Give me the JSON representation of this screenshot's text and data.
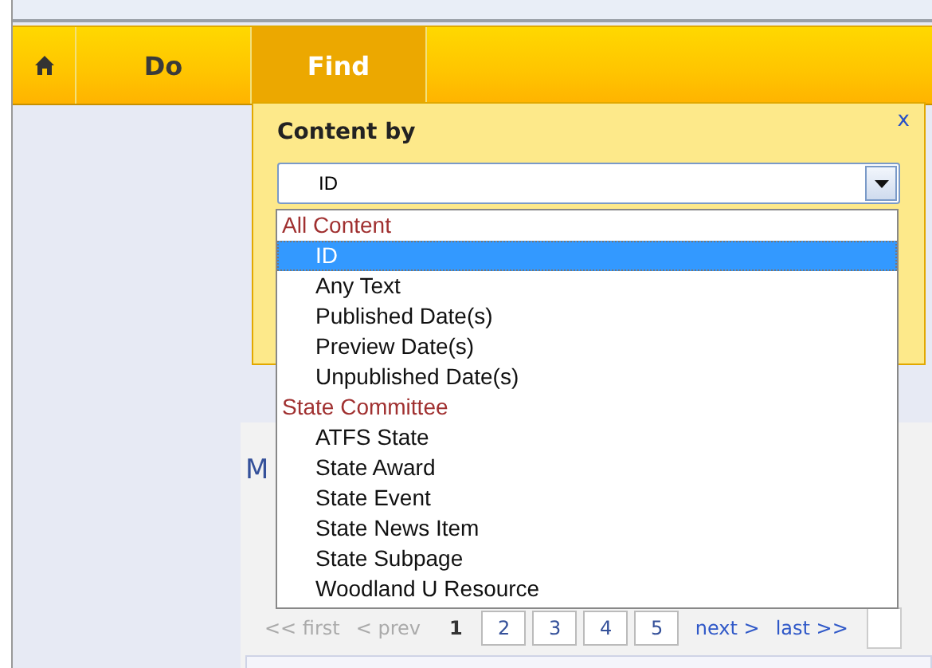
{
  "nav": {
    "tabs": [
      {
        "kind": "home",
        "selected": false
      },
      {
        "kind": "text",
        "label": "Do",
        "selected": false
      },
      {
        "kind": "text",
        "label": "Find",
        "selected": true
      }
    ]
  },
  "panel": {
    "title": "Content by",
    "close": "x",
    "select": {
      "value": "ID"
    },
    "options": [
      {
        "kind": "group",
        "label": "All Content"
      },
      {
        "kind": "option",
        "label": "ID",
        "selected": true
      },
      {
        "kind": "option",
        "label": "Any Text",
        "selected": false
      },
      {
        "kind": "option",
        "label": "Published Date(s)",
        "selected": false
      },
      {
        "kind": "option",
        "label": "Preview Date(s)",
        "selected": false
      },
      {
        "kind": "option",
        "label": "Unpublished Date(s)",
        "selected": false
      },
      {
        "kind": "group",
        "label": "State Committee"
      },
      {
        "kind": "option",
        "label": "ATFS State",
        "selected": false
      },
      {
        "kind": "option",
        "label": "State Award",
        "selected": false
      },
      {
        "kind": "option",
        "label": "State Event",
        "selected": false
      },
      {
        "kind": "option",
        "label": "State News Item",
        "selected": false
      },
      {
        "kind": "option",
        "label": "State Subpage",
        "selected": false
      },
      {
        "kind": "option",
        "label": "Woodland U Resource",
        "selected": false
      }
    ]
  },
  "content": {
    "heading": "M",
    "pager": {
      "first": "<< first",
      "prev": "< prev",
      "pages": [
        {
          "label": "1",
          "selected": true
        },
        {
          "label": "2",
          "selected": false
        },
        {
          "label": "3",
          "selected": false
        },
        {
          "label": "4",
          "selected": false
        },
        {
          "label": "5",
          "selected": false
        }
      ],
      "next": "next >",
      "last": "last >>"
    }
  }
}
